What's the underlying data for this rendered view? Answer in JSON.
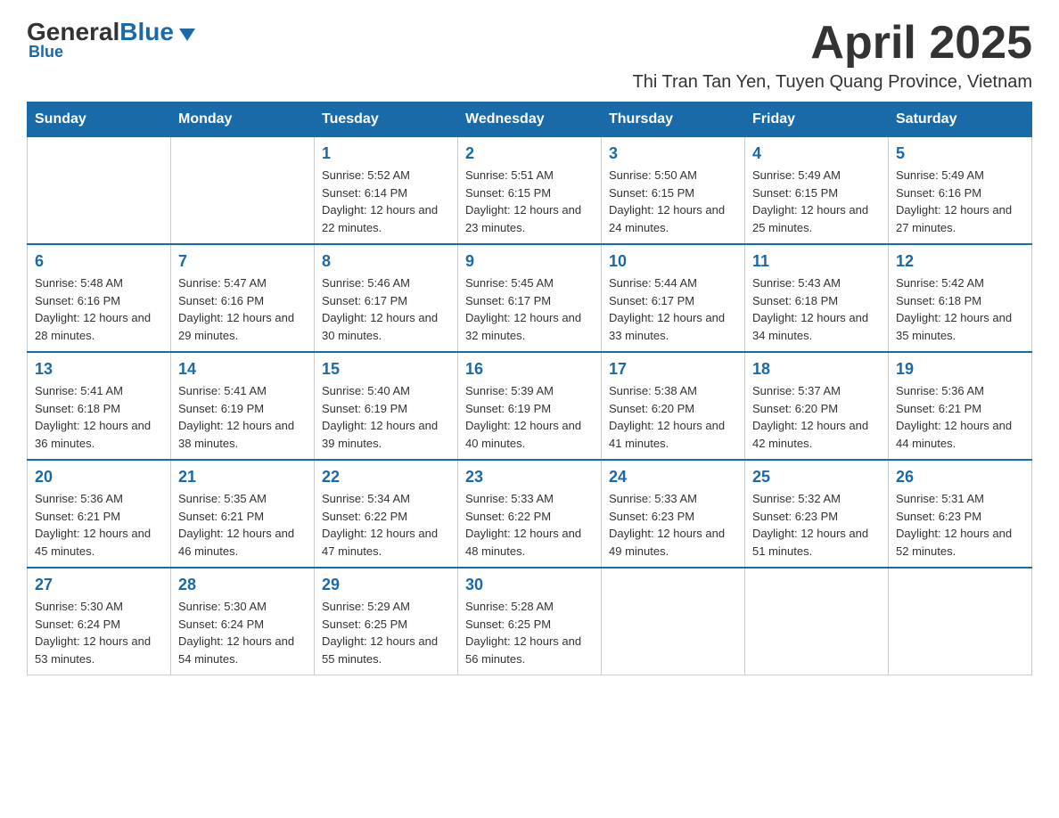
{
  "logo": {
    "general": "General",
    "blue": "Blue",
    "tagline": "Blue"
  },
  "header": {
    "title": "April 2025",
    "location": "Thi Tran Tan Yen, Tuyen Quang Province, Vietnam"
  },
  "days_of_week": [
    "Sunday",
    "Monday",
    "Tuesday",
    "Wednesday",
    "Thursday",
    "Friday",
    "Saturday"
  ],
  "weeks": [
    [
      {
        "day": "",
        "sunrise": "",
        "sunset": "",
        "daylight": ""
      },
      {
        "day": "",
        "sunrise": "",
        "sunset": "",
        "daylight": ""
      },
      {
        "day": "1",
        "sunrise": "Sunrise: 5:52 AM",
        "sunset": "Sunset: 6:14 PM",
        "daylight": "Daylight: 12 hours and 22 minutes."
      },
      {
        "day": "2",
        "sunrise": "Sunrise: 5:51 AM",
        "sunset": "Sunset: 6:15 PM",
        "daylight": "Daylight: 12 hours and 23 minutes."
      },
      {
        "day": "3",
        "sunrise": "Sunrise: 5:50 AM",
        "sunset": "Sunset: 6:15 PM",
        "daylight": "Daylight: 12 hours and 24 minutes."
      },
      {
        "day": "4",
        "sunrise": "Sunrise: 5:49 AM",
        "sunset": "Sunset: 6:15 PM",
        "daylight": "Daylight: 12 hours and 25 minutes."
      },
      {
        "day": "5",
        "sunrise": "Sunrise: 5:49 AM",
        "sunset": "Sunset: 6:16 PM",
        "daylight": "Daylight: 12 hours and 27 minutes."
      }
    ],
    [
      {
        "day": "6",
        "sunrise": "Sunrise: 5:48 AM",
        "sunset": "Sunset: 6:16 PM",
        "daylight": "Daylight: 12 hours and 28 minutes."
      },
      {
        "day": "7",
        "sunrise": "Sunrise: 5:47 AM",
        "sunset": "Sunset: 6:16 PM",
        "daylight": "Daylight: 12 hours and 29 minutes."
      },
      {
        "day": "8",
        "sunrise": "Sunrise: 5:46 AM",
        "sunset": "Sunset: 6:17 PM",
        "daylight": "Daylight: 12 hours and 30 minutes."
      },
      {
        "day": "9",
        "sunrise": "Sunrise: 5:45 AM",
        "sunset": "Sunset: 6:17 PM",
        "daylight": "Daylight: 12 hours and 32 minutes."
      },
      {
        "day": "10",
        "sunrise": "Sunrise: 5:44 AM",
        "sunset": "Sunset: 6:17 PM",
        "daylight": "Daylight: 12 hours and 33 minutes."
      },
      {
        "day": "11",
        "sunrise": "Sunrise: 5:43 AM",
        "sunset": "Sunset: 6:18 PM",
        "daylight": "Daylight: 12 hours and 34 minutes."
      },
      {
        "day": "12",
        "sunrise": "Sunrise: 5:42 AM",
        "sunset": "Sunset: 6:18 PM",
        "daylight": "Daylight: 12 hours and 35 minutes."
      }
    ],
    [
      {
        "day": "13",
        "sunrise": "Sunrise: 5:41 AM",
        "sunset": "Sunset: 6:18 PM",
        "daylight": "Daylight: 12 hours and 36 minutes."
      },
      {
        "day": "14",
        "sunrise": "Sunrise: 5:41 AM",
        "sunset": "Sunset: 6:19 PM",
        "daylight": "Daylight: 12 hours and 38 minutes."
      },
      {
        "day": "15",
        "sunrise": "Sunrise: 5:40 AM",
        "sunset": "Sunset: 6:19 PM",
        "daylight": "Daylight: 12 hours and 39 minutes."
      },
      {
        "day": "16",
        "sunrise": "Sunrise: 5:39 AM",
        "sunset": "Sunset: 6:19 PM",
        "daylight": "Daylight: 12 hours and 40 minutes."
      },
      {
        "day": "17",
        "sunrise": "Sunrise: 5:38 AM",
        "sunset": "Sunset: 6:20 PM",
        "daylight": "Daylight: 12 hours and 41 minutes."
      },
      {
        "day": "18",
        "sunrise": "Sunrise: 5:37 AM",
        "sunset": "Sunset: 6:20 PM",
        "daylight": "Daylight: 12 hours and 42 minutes."
      },
      {
        "day": "19",
        "sunrise": "Sunrise: 5:36 AM",
        "sunset": "Sunset: 6:21 PM",
        "daylight": "Daylight: 12 hours and 44 minutes."
      }
    ],
    [
      {
        "day": "20",
        "sunrise": "Sunrise: 5:36 AM",
        "sunset": "Sunset: 6:21 PM",
        "daylight": "Daylight: 12 hours and 45 minutes."
      },
      {
        "day": "21",
        "sunrise": "Sunrise: 5:35 AM",
        "sunset": "Sunset: 6:21 PM",
        "daylight": "Daylight: 12 hours and 46 minutes."
      },
      {
        "day": "22",
        "sunrise": "Sunrise: 5:34 AM",
        "sunset": "Sunset: 6:22 PM",
        "daylight": "Daylight: 12 hours and 47 minutes."
      },
      {
        "day": "23",
        "sunrise": "Sunrise: 5:33 AM",
        "sunset": "Sunset: 6:22 PM",
        "daylight": "Daylight: 12 hours and 48 minutes."
      },
      {
        "day": "24",
        "sunrise": "Sunrise: 5:33 AM",
        "sunset": "Sunset: 6:23 PM",
        "daylight": "Daylight: 12 hours and 49 minutes."
      },
      {
        "day": "25",
        "sunrise": "Sunrise: 5:32 AM",
        "sunset": "Sunset: 6:23 PM",
        "daylight": "Daylight: 12 hours and 51 minutes."
      },
      {
        "day": "26",
        "sunrise": "Sunrise: 5:31 AM",
        "sunset": "Sunset: 6:23 PM",
        "daylight": "Daylight: 12 hours and 52 minutes."
      }
    ],
    [
      {
        "day": "27",
        "sunrise": "Sunrise: 5:30 AM",
        "sunset": "Sunset: 6:24 PM",
        "daylight": "Daylight: 12 hours and 53 minutes."
      },
      {
        "day": "28",
        "sunrise": "Sunrise: 5:30 AM",
        "sunset": "Sunset: 6:24 PM",
        "daylight": "Daylight: 12 hours and 54 minutes."
      },
      {
        "day": "29",
        "sunrise": "Sunrise: 5:29 AM",
        "sunset": "Sunset: 6:25 PM",
        "daylight": "Daylight: 12 hours and 55 minutes."
      },
      {
        "day": "30",
        "sunrise": "Sunrise: 5:28 AM",
        "sunset": "Sunset: 6:25 PM",
        "daylight": "Daylight: 12 hours and 56 minutes."
      },
      {
        "day": "",
        "sunrise": "",
        "sunset": "",
        "daylight": ""
      },
      {
        "day": "",
        "sunrise": "",
        "sunset": "",
        "daylight": ""
      },
      {
        "day": "",
        "sunrise": "",
        "sunset": "",
        "daylight": ""
      }
    ]
  ]
}
